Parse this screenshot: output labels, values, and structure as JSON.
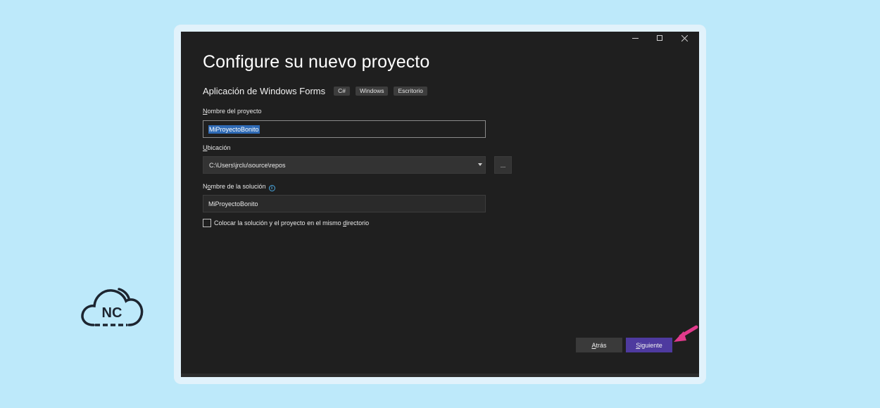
{
  "dialog": {
    "title": "Configure su nuevo proyecto",
    "template": {
      "name": "Aplicación de Windows Forms",
      "tags": [
        "C#",
        "Windows",
        "Escritorio"
      ]
    },
    "project_name": {
      "label_accel": "N",
      "label_rest": "ombre del proyecto",
      "value": "MiProyectoBonito"
    },
    "location": {
      "label_accel": "U",
      "label_rest": "bicación",
      "value": "C:\\Users\\jrclu\\source\\repos",
      "browse_label": "..."
    },
    "solution_name": {
      "label_pre": "N",
      "label_accel": "o",
      "label_rest": "mbre de la solución",
      "value": "MiProyectoBonito",
      "info_icon": "info-icon"
    },
    "same_directory": {
      "label_pre": "Colocar la solución y el proyecto en el mismo ",
      "label_accel": "d",
      "label_rest": "irectorio",
      "checked": false
    },
    "buttons": {
      "back_accel": "A",
      "back_rest": "trás",
      "next_accel": "S",
      "next_rest": "iguiente"
    }
  },
  "logo": {
    "text": "NC"
  },
  "colors": {
    "page_bg": "#bde9fa",
    "window_bg": "#1f1f1f",
    "primary_button": "#4e3a9f",
    "arrow": "#e23a8c"
  }
}
